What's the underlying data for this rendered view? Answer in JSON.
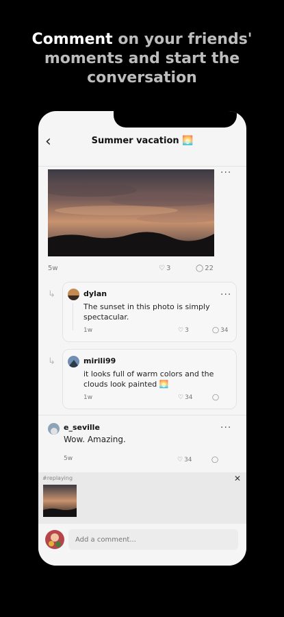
{
  "promo": {
    "line1_bold": "Comment",
    "line1_rest": " on your friends'",
    "line2": "moments and start the",
    "line3": "conversation"
  },
  "header": {
    "title": "Summer vacation 🌅"
  },
  "post": {
    "age": "5w",
    "likes": "3",
    "comments": "22"
  },
  "comments": [
    {
      "user": "dylan",
      "text": "The sunset in this photo is simply spectacular.",
      "age": "1w",
      "likes": "3",
      "replies": "34"
    },
    {
      "user": "mirili99",
      "text": "it looks full of warm colors and the clouds look painted 🌅",
      "age": "1w",
      "likes": "34",
      "replies": ""
    },
    {
      "user": "e_seville",
      "text": "Wow. Amazing.",
      "age": "5w",
      "likes": "34",
      "replies": ""
    }
  ],
  "reply": {
    "label": "#replaying"
  },
  "composer": {
    "placeholder": "Add a comment..."
  }
}
